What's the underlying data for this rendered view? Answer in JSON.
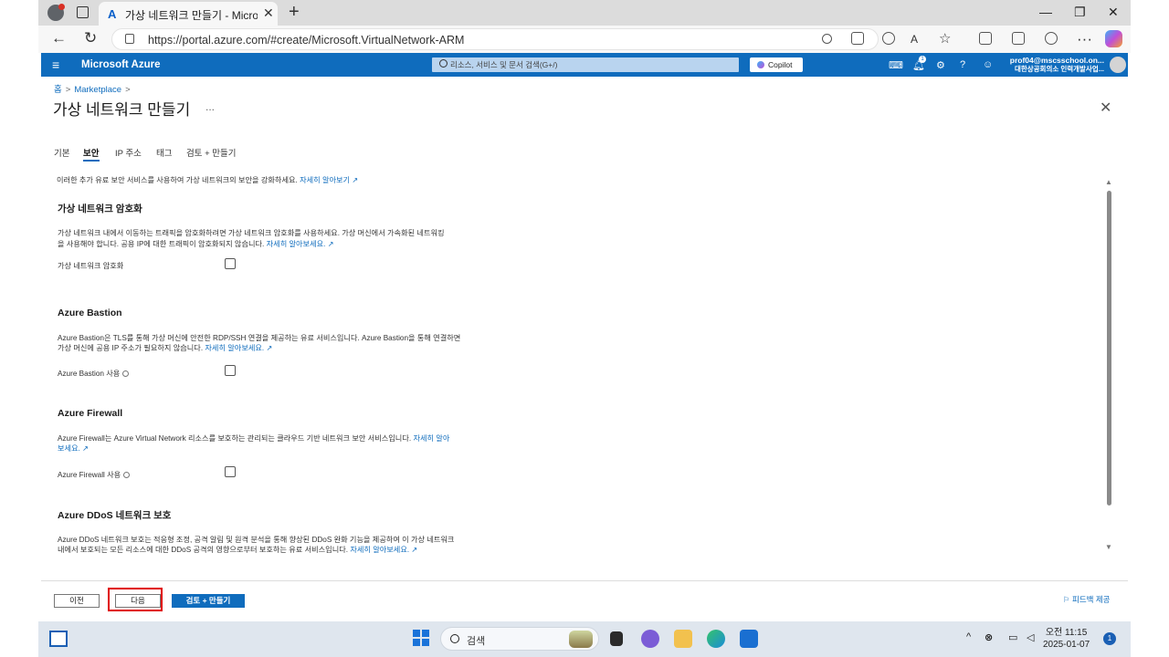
{
  "browser": {
    "tab_title": "가상 네트워크 만들기 - Microsoft",
    "tab_close": "✕",
    "new_tab": "+",
    "url": "https://portal.azure.com/#create/Microsoft.VirtualNetwork-ARM",
    "azure_logo": "A"
  },
  "azure": {
    "brand": "Microsoft Azure",
    "search_placeholder": "리소스, 서비스 및 문서 검색(G+/)",
    "copilot_label": "Copilot",
    "notification_count": "1",
    "user_email": "prof04@mscsschool.on...",
    "user_org": "대한상공회의소 인력개발사업..."
  },
  "page": {
    "breadcrumb": [
      "홈",
      "Marketplace"
    ],
    "title": "가상 네트워크 만들기",
    "more": "...",
    "close": "✕",
    "tabs": [
      "기본",
      "보안",
      "IP 주소",
      "태그",
      "검토 + 만들기"
    ],
    "active_tab": "보안"
  },
  "content": {
    "intro": "이러한 추가 유료 보안 서비스를 사용하여 가상 네트워크의 보안을 강화하세요.",
    "intro_link": "자세히 알아보기",
    "encryption": {
      "heading": "가상 네트워크 암호화",
      "desc1": "가상 네트워크 내에서 이동하는 트래픽을 암호화하려면 가상 네트워크 암호화를 사용하세요. 가상 머신에서 가속화된 네트워킹",
      "desc2": "을 사용해야 합니다. 공용 IP에 대한 트래픽이 암호화되지 않습니다.",
      "link": "자세히 알아보세요.",
      "field_label": "가상 네트워크 암호화",
      "checked": false
    },
    "bastion": {
      "heading": "Azure Bastion",
      "desc1": "Azure Bastion은 TLS를 통해 가상 머신에 안전한 RDP/SSH 연결을 제공하는 유료 서비스입니다. Azure Bastion을 통해 연결하면",
      "desc2": "가상 머신에 공용 IP 주소가 필요하지 않습니다.",
      "link": "자세히 알아보세요.",
      "field_label": "Azure Bastion 사용",
      "checked": false
    },
    "firewall": {
      "heading": "Azure Firewall",
      "desc1": "Azure Firewall는 Azure Virtual Network 리소스를 보호하는 관리되는 클라우드 기반 네트워크 보안 서비스입니다.",
      "link1": "자세히 알아",
      "link2": "보세요.",
      "field_label": "Azure Firewall 사용",
      "checked": false
    },
    "ddos": {
      "heading": "Azure DDoS 네트워크 보호",
      "desc1": "Azure DDoS 네트워크 보호는 적응형 조정, 공격 알림 및 원격 분석을 통해 향상된 DDoS 완화 기능을 제공하여 이 가상 네트워크",
      "desc2": "내에서 보호되는 모든 리소스에 대한 DDoS 공격의 영향으로부터 보호하는 유료 서비스입니다.",
      "link": "자세히 알아보세요."
    }
  },
  "footer": {
    "prev": "이전",
    "next": "다음",
    "review": "검토 + 만들기",
    "feedback": "피드백 제공"
  },
  "taskbar": {
    "search": "검색",
    "time": "오전 11:15",
    "date": "2025-01-07",
    "badge": "1"
  },
  "colors": {
    "azure_blue": "#0f6cbd",
    "highlight_red": "#e00000"
  }
}
